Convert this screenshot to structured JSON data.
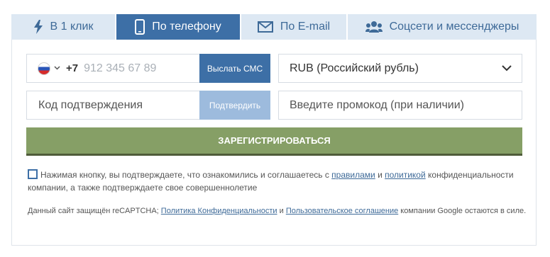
{
  "tabs": [
    {
      "label": "В 1 клик",
      "icon": "lightning-icon",
      "active": false
    },
    {
      "label": "По телефону",
      "icon": "phone-icon",
      "active": true
    },
    {
      "label": "По E-mail",
      "icon": "envelope-icon",
      "active": false
    },
    {
      "label": "Соцсети и мессенджеры",
      "icon": "people-icon",
      "active": false
    }
  ],
  "phone": {
    "country_flag": "russia-flag-icon",
    "country_code": "+7",
    "placeholder": "912 345 67 89",
    "send_sms_label": "Выслать СМС"
  },
  "currency": {
    "selected": "RUB (Российский рубль)"
  },
  "confirmation": {
    "placeholder": "Код подтверждения",
    "confirm_label": "Подтвердить"
  },
  "promo": {
    "placeholder": "Введите промокод (при наличии)"
  },
  "register_label": "ЗАРЕГИСТРИРОВАТЬСЯ",
  "agreement": {
    "text_before": "Нажимая кнопку, вы подтверждаете, что ознакомились и соглашаетесь с ",
    "link_rules": "правилами",
    "and": " и ",
    "link_policy": "политикой",
    "text_after": " конфиденциальности компании, а также подтверждаете свое совершеннолетие"
  },
  "captcha": {
    "text_before": "Данный сайт защищён reCAPTCHA; ",
    "link_privacy": "Политика Конфиденциальности",
    "and": " и ",
    "link_terms": "Пользовательское соглашение",
    "text_after": " компании Google остаются в силе."
  },
  "colors": {
    "accent": "#3d6fa6",
    "tab_bg": "#dde8f3",
    "register": "#869f66",
    "confirm_disabled": "#9dbbdd"
  }
}
